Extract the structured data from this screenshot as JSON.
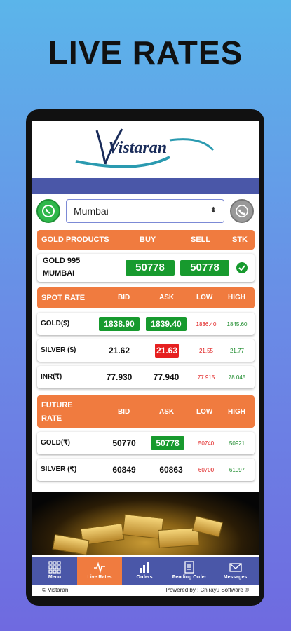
{
  "headline": "LIVE RATES",
  "brand": {
    "logo_text": "Vistaran"
  },
  "location": {
    "selected": "Mumbai"
  },
  "gold_products": {
    "headers": [
      "GOLD PRODUCTS",
      "BUY",
      "SELL",
      "STK"
    ],
    "rows": [
      {
        "name_line1": "GOLD 995",
        "name_line2": "MUMBAI",
        "buy": "50778",
        "sell": "50778"
      }
    ]
  },
  "spot": {
    "headers": [
      "SPOT RATE",
      "BID",
      "ASK",
      "LOW",
      "HIGH"
    ],
    "rows": [
      {
        "name": "GOLD($)",
        "bid": "1838.90",
        "ask": "1839.40",
        "low": "1836.40",
        "high": "1845.60"
      },
      {
        "name": "SILVER ($)",
        "bid": "21.62",
        "ask": "21.63",
        "low": "21.55",
        "high": "21.77"
      },
      {
        "name": "INR(₹)",
        "bid": "77.930",
        "ask": "77.940",
        "low": "77.915",
        "high": "78.045"
      }
    ]
  },
  "future": {
    "headers": [
      "FUTURE",
      "RATE",
      "BID",
      "ASK",
      "LOW",
      "HIGH"
    ],
    "rows": [
      {
        "name": "GOLD(₹)",
        "bid": "50770",
        "ask": "50778",
        "low": "50740",
        "high": "50921"
      },
      {
        "name": "SILVER (₹)",
        "bid": "60849",
        "ask": "60863",
        "low": "60700",
        "high": "61097"
      }
    ]
  },
  "tabs": [
    "Menu",
    "Live Rates",
    "Orders",
    "Pending Order",
    "Messages"
  ],
  "footer": {
    "left": "© Vistaran",
    "right": "Powered by : Chirayu Software ®"
  },
  "colors": {
    "accent": "#f07b3f",
    "nav": "#4a57a8",
    "up": "#179a2e",
    "down": "#e62020"
  }
}
